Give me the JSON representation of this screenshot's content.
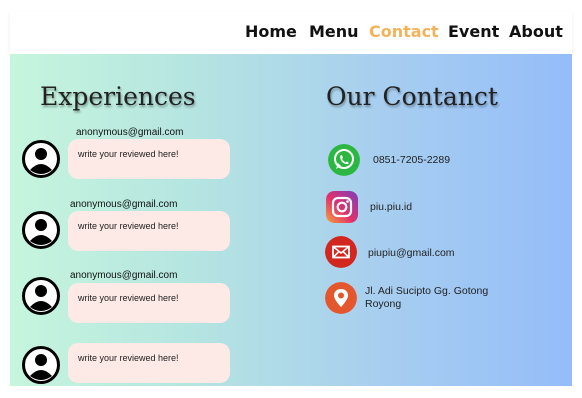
{
  "nav": {
    "items": [
      {
        "label": "Home"
      },
      {
        "label": "Menu"
      },
      {
        "label": "Contact",
        "active": true
      },
      {
        "label": "Event"
      },
      {
        "label": "About"
      }
    ],
    "active_color": "#f4b35b"
  },
  "experiences": {
    "title": "Experiences",
    "reviews": [
      {
        "email": "anonymous@gmail.com",
        "text": "write your reviewed here!"
      },
      {
        "email": "anonymous@gmail.com",
        "text": "write your reviewed here!"
      },
      {
        "email": "anonymous@gmail.com",
        "text": "write your reviewed here!"
      },
      {
        "email": "",
        "text": "write your reviewed here!"
      }
    ]
  },
  "contact": {
    "title": "Our Contanct",
    "items": [
      {
        "icon": "whatsapp-icon",
        "text": "0851-7205-2289"
      },
      {
        "icon": "instagram-icon",
        "text": "piu.piu.id"
      },
      {
        "icon": "mail-icon",
        "text": "piupiu@gmail.com"
      },
      {
        "icon": "location-pin-icon",
        "text": "Jl. Adi Sucipto Gg. Gotong Royong"
      }
    ]
  }
}
